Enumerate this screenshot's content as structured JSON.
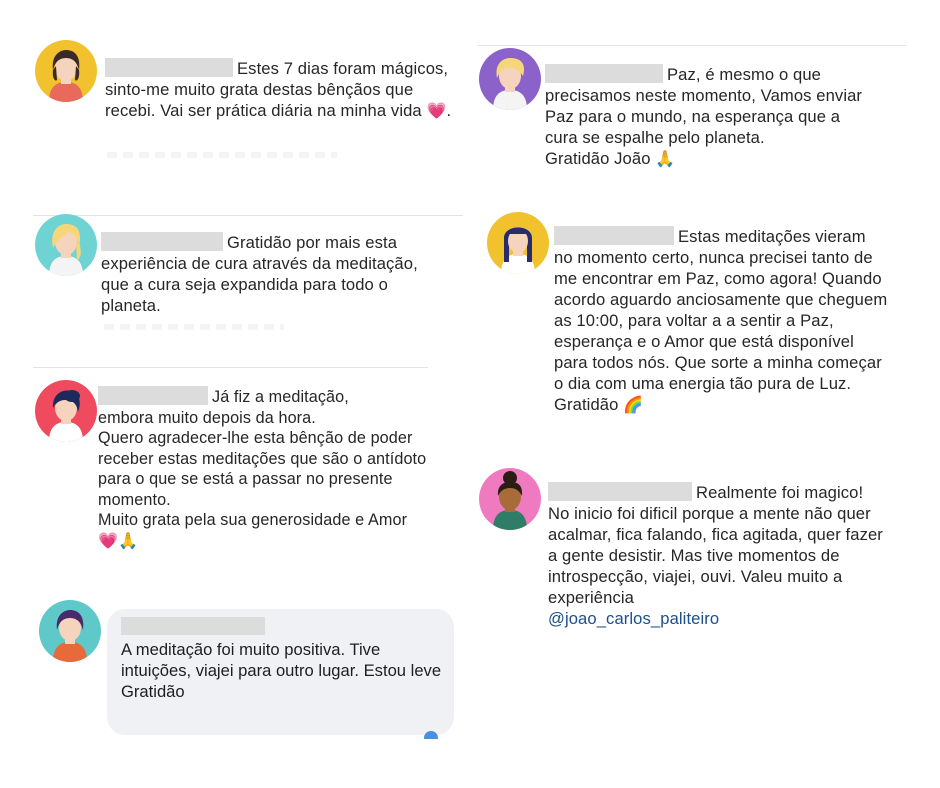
{
  "comments": [
    {
      "id": "c1",
      "avatar": {
        "bg": "#f2c12e",
        "hair": "#3b2a26",
        "skin": "#f6d3bd",
        "shirt": "#e86a5a",
        "style": "short-dark"
      },
      "text": "Estes 7 dias foram mágicos, sinto-me muito grata destas bênçãos que recebi. Vai ser prática diária na minha vida ",
      "emoji": "💗",
      "after": "."
    },
    {
      "id": "c2",
      "avatar": {
        "bg": "#8b62c9",
        "hair": "#f5d77a",
        "skin": "#f6d3bd",
        "shirt": "#f4f4f4",
        "style": "short-blonde"
      },
      "text": "Paz, é mesmo o que precisamos neste momento, Vamos enviar Paz para o mundo, na esperança que a cura se espalhe pelo planeta.",
      "line2": "Gratidão João ",
      "emoji": "🙏"
    },
    {
      "id": "c3",
      "avatar": {
        "bg": "#6fd3d3",
        "hair": "#f5d77a",
        "skin": "#f6d3bd",
        "shirt": "#f4f4f4",
        "style": "long-blonde"
      },
      "text": "Gratidão por mais esta experiência de cura através da meditação, que a cura seja expandida para todo o planeta."
    },
    {
      "id": "c4",
      "avatar": {
        "bg": "#f2c12e",
        "hair": "#2a2a6e",
        "skin": "#f6d3bd",
        "shirt": "#ffffff",
        "style": "long-dark"
      },
      "text": "Estas meditações vieram no momento certo, nunca precisei tanto de me encontrar em Paz, como agora! Quando acordo aguardo anciosamente que cheguem as 10:00, para voltar a a sentir a Paz, esperança e o Amor que está disponível para todos nós. Que sorte a minha começar o dia com uma energia tão pura de Luz. Gratidão ",
      "emoji": "🌈"
    },
    {
      "id": "c5",
      "avatar": {
        "bg": "#f04a5e",
        "hair": "#1f2a5c",
        "skin": "#f6d3bd",
        "shirt": "#ffffff",
        "style": "short-navy"
      },
      "line1": "Já fiz a meditação,",
      "line2": "embora muito depois da hora.",
      "line3": "Quero agradecer-lhe esta bênção de poder receber estas meditações que são o antídoto para o que se está a passar no presente momento.",
      "line4": "Muito grata pela sua generosidade e Amor ",
      "emoji": "💗🙏"
    },
    {
      "id": "c6",
      "avatar": {
        "bg": "#f07ac0",
        "hair": "#2a1d16",
        "skin": "#a86b3a",
        "shirt": "#2f7d66",
        "style": "bun"
      },
      "text": "Realmente foi magico! No inicio foi dificil porque a mente não quer acalmar, fica falando, fica agitada, quer fazer a gente desistir. Mas tive momentos de introspecção, viajei, ouvi. Valeu muito a experiência",
      "mention": "@joao_carlos_paliteiro"
    },
    {
      "id": "c7",
      "avatar": {
        "bg": "#5fc8c8",
        "hair": "#4a2a6a",
        "skin": "#f6d3bd",
        "shirt": "#e86a3a",
        "style": "short-purple"
      },
      "text": "A meditação foi muito positiva. Tive intuições, viajei para outro lugar. Estou leve",
      "line2": "Gratidão"
    }
  ]
}
